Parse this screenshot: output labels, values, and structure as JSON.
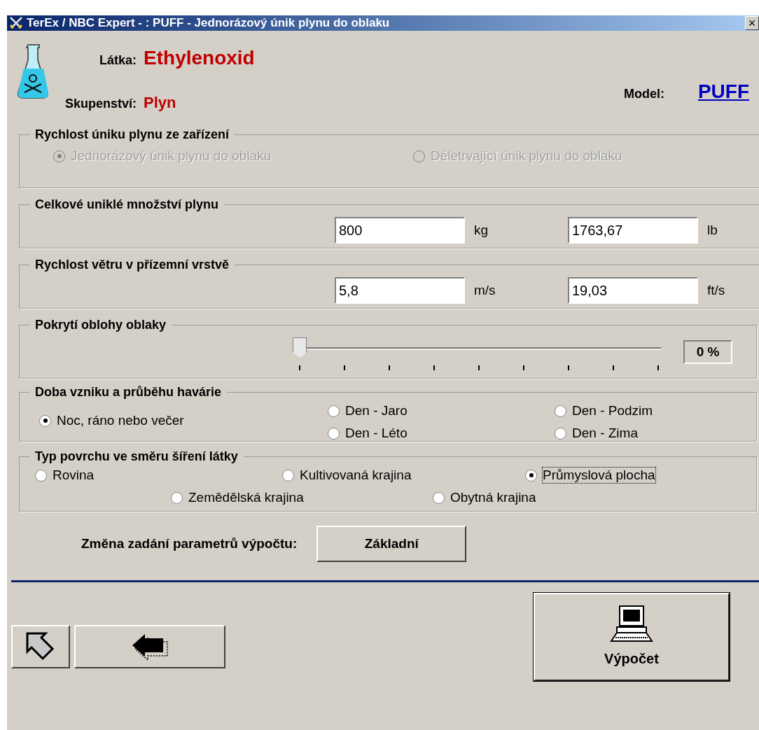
{
  "window": {
    "title": "TerEx / NBC Expert - : PUFF - Jednorázový únik plynu do oblaku",
    "close": "×"
  },
  "header": {
    "substance_label": "Látka:",
    "substance": "Ethylenoxid",
    "state_label": "Skupenství:",
    "state": "Plyn",
    "model_label": "Model:",
    "model": "PUFF"
  },
  "release_rate": {
    "title": "Rychlost úniku plynu ze zařízení",
    "options": [
      {
        "label": "Jednorázový únik plynu do oblaku",
        "selected": true,
        "disabled": true
      },
      {
        "label": "Déletrvající únik plynu do oblaku",
        "selected": false,
        "disabled": true
      }
    ]
  },
  "total_amount": {
    "title": "Celkové uniklé množství plynu",
    "fields": [
      {
        "value": "800",
        "unit": "kg"
      },
      {
        "value": "1763,67",
        "unit": "lb"
      }
    ]
  },
  "wind_speed": {
    "title": "Rychlost větru v přízemní vrstvě",
    "fields": [
      {
        "value": "5,8",
        "unit": "m/s"
      },
      {
        "value": "19,03",
        "unit": "ft/s"
      }
    ]
  },
  "cloud_cover": {
    "title": "Pokrytí oblohy oblaky",
    "level": 0,
    "reading": "0 %"
  },
  "accident_time": {
    "title": "Doba vzniku a průběhu havárie",
    "options": [
      {
        "label": "Noc, ráno nebo večer",
        "selected": true
      },
      {
        "label": "Den - Jaro",
        "selected": false
      },
      {
        "label": "Den - Léto",
        "selected": false
      },
      {
        "label": "Den - Podzim",
        "selected": false
      },
      {
        "label": "Den - Zima",
        "selected": false
      }
    ]
  },
  "surface_type": {
    "title": "Typ povrchu ve směru šíření látky",
    "options": [
      {
        "label": "Rovina",
        "selected": false,
        "focused": false
      },
      {
        "label": "Kultivovaná krajina",
        "selected": false,
        "focused": false
      },
      {
        "label": "Průmyslová plocha",
        "selected": true,
        "focused": true
      },
      {
        "label": "Zemědělská krajina",
        "selected": false,
        "focused": false
      },
      {
        "label": "Obytná krajina",
        "selected": false,
        "focused": false
      }
    ]
  },
  "parameter_change": {
    "label": "Změna zadání parametrů výpočtu:",
    "button": "Základní"
  },
  "compute_button": "Výpočet"
}
